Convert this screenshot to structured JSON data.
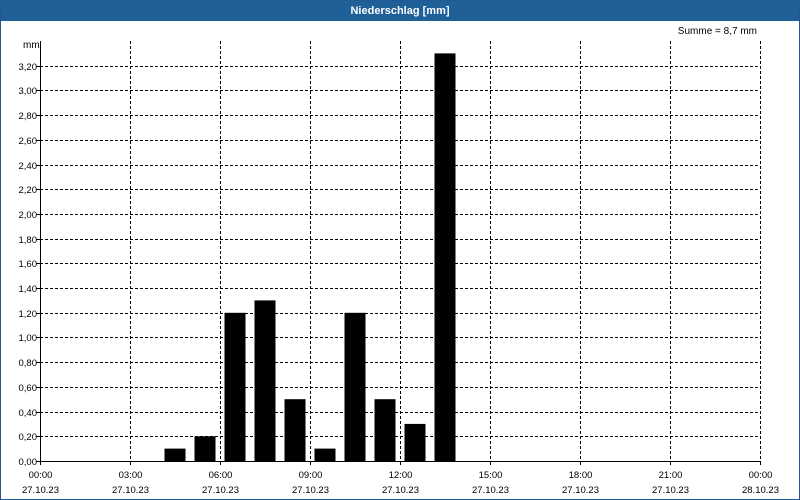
{
  "window": {
    "title": "Niederschlag [mm]"
  },
  "summary": "Summe = 8,7 mm",
  "unit_label": "mm",
  "colors": {
    "titlebar": "#1f6098",
    "bars": "#000000",
    "grid": "#000000"
  },
  "chart_data": {
    "type": "bar",
    "title": "Niederschlag [mm]",
    "ylabel": "mm",
    "xlabel": "",
    "ylim": [
      0,
      3.4
    ],
    "y_ticks": [
      "0,00",
      "0,20",
      "0,40",
      "0,60",
      "0,80",
      "1,00",
      "1,20",
      "1,40",
      "1,60",
      "1,80",
      "2,00",
      "2,20",
      "2,40",
      "2,60",
      "2,80",
      "3,00",
      "3,20"
    ],
    "y_tick_values": [
      0,
      0.2,
      0.4,
      0.6,
      0.8,
      1.0,
      1.2,
      1.4,
      1.6,
      1.8,
      2.0,
      2.2,
      2.4,
      2.6,
      2.8,
      3.0,
      3.2
    ],
    "x_range_hours": [
      0,
      24
    ],
    "x_ticks": [
      {
        "time": "00:00",
        "date": "27.10.23"
      },
      {
        "time": "03:00",
        "date": "27.10.23"
      },
      {
        "time": "06:00",
        "date": "27.10.23"
      },
      {
        "time": "09:00",
        "date": "27.10.23"
      },
      {
        "time": "12:00",
        "date": "27.10.23"
      },
      {
        "time": "15:00",
        "date": "27.10.23"
      },
      {
        "time": "18:00",
        "date": "27.10.23"
      },
      {
        "time": "21:00",
        "date": "27.10.23"
      },
      {
        "time": "00:00",
        "date": "28.10.23"
      }
    ],
    "grid": true,
    "bars": [
      {
        "time": "04:00",
        "value": 0.1
      },
      {
        "time": "05:00",
        "value": 0.2
      },
      {
        "time": "06:00",
        "value": 1.2
      },
      {
        "time": "07:00",
        "value": 1.3
      },
      {
        "time": "08:00",
        "value": 0.5
      },
      {
        "time": "09:00",
        "value": 0.1
      },
      {
        "time": "10:00",
        "value": 1.2
      },
      {
        "time": "11:00",
        "value": 0.5
      },
      {
        "time": "12:00",
        "value": 0.3
      },
      {
        "time": "13:00",
        "value": 3.3
      }
    ]
  }
}
